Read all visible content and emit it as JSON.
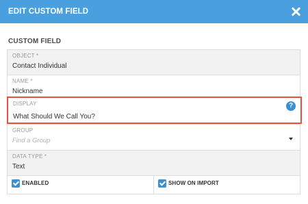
{
  "dialog": {
    "title": "EDIT CUSTOM FIELD"
  },
  "section": {
    "title": "CUSTOM FIELD"
  },
  "fields": {
    "object": {
      "label": "OBJECT *",
      "value": "Contact Individual"
    },
    "name": {
      "label": "NAME *",
      "value": "Nickname"
    },
    "display": {
      "label": "DISPLAY",
      "value": "What Should We Call You?",
      "help_icon": "question-icon"
    },
    "group": {
      "label": "GROUP",
      "placeholder": "Find a Group"
    },
    "data_type": {
      "label": "DATA TYPE *",
      "value": "Text"
    }
  },
  "checkboxes": {
    "enabled": {
      "label": "ENABLED",
      "checked": true
    },
    "show_on_import": {
      "label": "SHOW ON IMPORT",
      "checked": true
    }
  },
  "colors": {
    "header": "#4a9fdf",
    "highlight_border": "#e5533f",
    "checkbox": "#3b8fd3"
  }
}
